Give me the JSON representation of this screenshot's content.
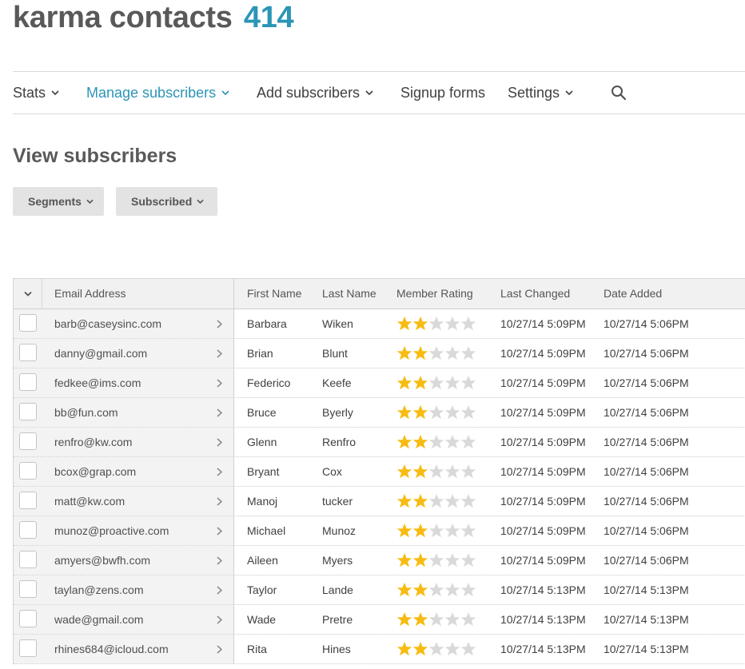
{
  "header": {
    "title": "karma contacts",
    "count": "414"
  },
  "nav": {
    "items": [
      {
        "label": "Stats"
      },
      {
        "label": "Manage subscribers"
      },
      {
        "label": "Add subscribers"
      },
      {
        "label": "Signup forms"
      },
      {
        "label": "Settings"
      }
    ],
    "search_icon": "search-icon"
  },
  "page": {
    "heading": "View subscribers",
    "filters": [
      {
        "label": "Segments"
      },
      {
        "label": "Subscribed"
      }
    ]
  },
  "table": {
    "columns": [
      "Email Address",
      "First Name",
      "Last Name",
      "Member Rating",
      "Last Changed",
      "Date Added"
    ],
    "max_rating": 5,
    "colors": {
      "star_filled": "#f7bb12",
      "star_empty": "#d9d9d9"
    },
    "rows": [
      {
        "email": "barb@caseysinc.com",
        "first": "Barbara",
        "last": "Wiken",
        "rating": 2,
        "changed": "10/27/14 5:09PM",
        "added": "10/27/14 5:06PM"
      },
      {
        "email": "danny@gmail.com",
        "first": "Brian",
        "last": "Blunt",
        "rating": 2,
        "changed": "10/27/14 5:09PM",
        "added": "10/27/14 5:06PM"
      },
      {
        "email": "fedkee@ims.com",
        "first": "Federico",
        "last": "Keefe",
        "rating": 2,
        "changed": "10/27/14 5:09PM",
        "added": "10/27/14 5:06PM"
      },
      {
        "email": "bb@fun.com",
        "first": "Bruce",
        "last": "Byerly",
        "rating": 2,
        "changed": "10/27/14 5:09PM",
        "added": "10/27/14 5:06PM"
      },
      {
        "email": "renfro@kw.com",
        "first": "Glenn",
        "last": "Renfro",
        "rating": 2,
        "changed": "10/27/14 5:09PM",
        "added": "10/27/14 5:06PM"
      },
      {
        "email": "bcox@grap.com",
        "first": "Bryant",
        "last": "Cox",
        "rating": 2,
        "changed": "10/27/14 5:09PM",
        "added": "10/27/14 5:06PM"
      },
      {
        "email": "matt@kw.com",
        "first": "Manoj",
        "last": "tucker",
        "rating": 2,
        "changed": "10/27/14 5:09PM",
        "added": "10/27/14 5:06PM"
      },
      {
        "email": "munoz@proactive.com",
        "first": "Michael",
        "last": "Munoz",
        "rating": 2,
        "changed": "10/27/14 5:09PM",
        "added": "10/27/14 5:06PM"
      },
      {
        "email": "amyers@bwfh.com",
        "first": "Aileen",
        "last": "Myers",
        "rating": 2,
        "changed": "10/27/14 5:09PM",
        "added": "10/27/14 5:06PM"
      },
      {
        "email": "taylan@zens.com",
        "first": "Taylor",
        "last": "Lande",
        "rating": 2,
        "changed": "10/27/14 5:13PM",
        "added": "10/27/14 5:13PM"
      },
      {
        "email": "wade@gmail.com",
        "first": "Wade",
        "last": "Pretre",
        "rating": 2,
        "changed": "10/27/14 5:13PM",
        "added": "10/27/14 5:13PM"
      },
      {
        "email": "rhines684@icloud.com",
        "first": "Rita",
        "last": "Hines",
        "rating": 2,
        "changed": "10/27/14 5:13PM",
        "added": "10/27/14 5:13PM"
      }
    ]
  }
}
